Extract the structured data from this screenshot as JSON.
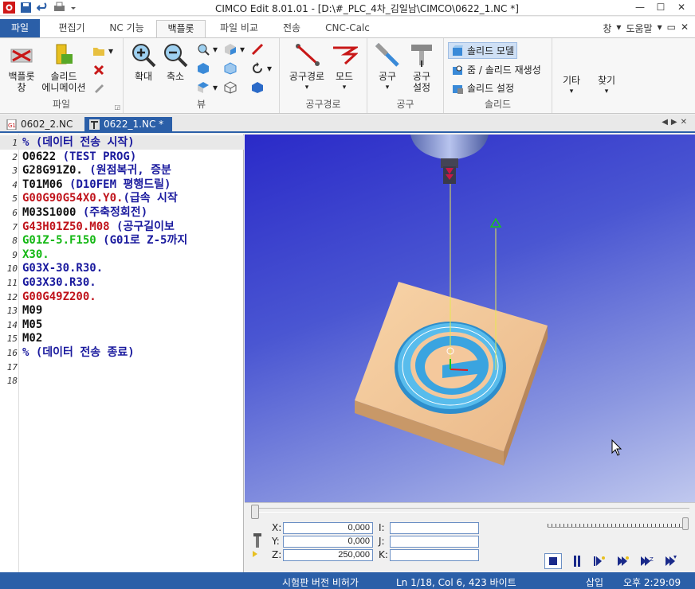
{
  "window": {
    "title": "CIMCO Edit 8.01.01 - [D:\\#_PLC_4차_김일남\\CIMCO\\0622_1.NC *]"
  },
  "menu": {
    "tabs": [
      "파일",
      "편집기",
      "NC 기능",
      "백플롯",
      "파일 비교",
      "전송",
      "CNC-Calc"
    ],
    "active": "백플롯",
    "right_items": [
      "창",
      "도움말"
    ]
  },
  "ribbon": {
    "backplot_window": "백플롯\n창",
    "solid_anim": "솔리드\n에니메이션",
    "group_file": "파일",
    "zoom_in": "확대",
    "zoom_out": "축소",
    "group_view": "뷰",
    "toolpath": "공구경로",
    "mode": "모드",
    "group_toolpath": "공구경로",
    "tool": "공구",
    "tool_setup": "공구\n설정",
    "group_tool": "공구",
    "solid_model": "솔리드 모델",
    "zoom_solid_regen": "줌 / 솔리드 재생성",
    "solid_setup": "솔리드 설정",
    "group_solid": "솔리드",
    "etc": "기타",
    "find": "찾기"
  },
  "doc_tabs": [
    {
      "name": "0602_2.NC",
      "active": false
    },
    {
      "name": "0622_1.NC *",
      "active": true
    }
  ],
  "code_lines": [
    {
      "n": "1",
      "parts": [
        [
          "c-blue",
          "% (데이터 전송 시작)"
        ]
      ]
    },
    {
      "n": "2",
      "parts": [
        [
          "c-blk",
          "O0622 "
        ],
        [
          "c-blue",
          "(TEST PROG)"
        ]
      ]
    },
    {
      "n": "3",
      "parts": [
        [
          "c-blk",
          "G28G91Z0. "
        ],
        [
          "c-blue",
          "(원점복귀, 증분"
        ]
      ]
    },
    {
      "n": "4",
      "parts": [
        [
          "c-blk",
          "T01M06 "
        ],
        [
          "c-blue",
          "(D10FEM 평행드릴)"
        ]
      ]
    },
    {
      "n": "5",
      "parts": [
        [
          "c-red",
          "G00G90G54X0.Y0."
        ],
        [
          "c-blue",
          "(급속 시작"
        ]
      ]
    },
    {
      "n": "6",
      "parts": [
        [
          "c-blk",
          "M03S1000 "
        ],
        [
          "c-blue",
          "(주축정회전)"
        ]
      ]
    },
    {
      "n": "7",
      "parts": [
        [
          "c-red",
          "G43H01Z50.M08 "
        ],
        [
          "c-blue",
          "(공구길이보"
        ]
      ]
    },
    {
      "n": "8",
      "parts": [
        [
          "c-grn",
          "G01Z-5.F150 "
        ],
        [
          "c-blue",
          "(G01로 Z-5까지"
        ]
      ]
    },
    {
      "n": "9",
      "parts": [
        [
          "c-grn",
          "X30."
        ]
      ]
    },
    {
      "n": "10",
      "parts": [
        [
          "c-blue",
          "G03X-30.R30."
        ]
      ]
    },
    {
      "n": "11",
      "parts": [
        [
          "c-blue",
          "G03X30.R30."
        ]
      ]
    },
    {
      "n": "12",
      "parts": [
        [
          "c-red",
          "G00G49Z200."
        ]
      ]
    },
    {
      "n": "13",
      "parts": [
        [
          "c-blk",
          "M09"
        ]
      ]
    },
    {
      "n": "14",
      "parts": [
        [
          "c-blk",
          "M05"
        ]
      ]
    },
    {
      "n": "15",
      "parts": [
        [
          "c-blk",
          "M02"
        ]
      ]
    },
    {
      "n": "16",
      "parts": [
        [
          "c-blue",
          "% (데이터 전송 종료)"
        ]
      ]
    },
    {
      "n": "17",
      "parts": []
    },
    {
      "n": "18",
      "parts": []
    }
  ],
  "coords": {
    "x_label": "X:",
    "x": "0,000",
    "y_label": "Y:",
    "y": "0,000",
    "z_label": "Z:",
    "z": "250,000",
    "i_label": "I:",
    "j_label": "J:",
    "k_label": "K:"
  },
  "status": {
    "trial": "시험판 버전 비허가",
    "position": "Ln 1/18, Col 6, 423 바이트",
    "mode": "삽입",
    "time": "오후 2:29:09"
  },
  "colors": {
    "accent": "#2b5fa8",
    "stock": "#f0c89a",
    "pocket": "#3ab0e8"
  }
}
